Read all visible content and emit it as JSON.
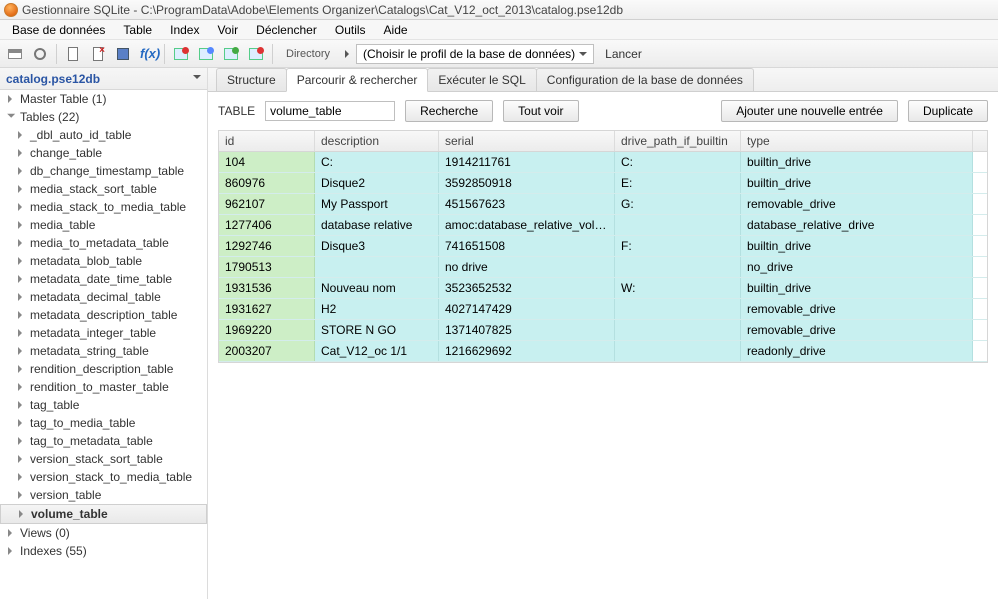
{
  "window": {
    "title": "Gestionnaire SQLite - C:\\ProgramData\\Adobe\\Elements Organizer\\Catalogs\\Cat_V12_oct_2013\\catalog.pse12db"
  },
  "menu": [
    "Base de données",
    "Table",
    "Index",
    "Voir",
    "Déclencher",
    "Outils",
    "Aide"
  ],
  "toolbar": {
    "directory_label": "Directory",
    "profile_placeholder": "(Choisir le profil de la base de données)",
    "launch": "Lancer"
  },
  "sidebar": {
    "title": "catalog.pse12db",
    "master": "Master Table (1)",
    "tables_label": "Tables (22)",
    "tables": [
      "_dbl_auto_id_table",
      "change_table",
      "db_change_timestamp_table",
      "media_stack_sort_table",
      "media_stack_to_media_table",
      "media_table",
      "media_to_metadata_table",
      "metadata_blob_table",
      "metadata_date_time_table",
      "metadata_decimal_table",
      "metadata_description_table",
      "metadata_integer_table",
      "metadata_string_table",
      "rendition_description_table",
      "rendition_to_master_table",
      "tag_table",
      "tag_to_media_table",
      "tag_to_metadata_table",
      "version_stack_sort_table",
      "version_stack_to_media_table",
      "version_table",
      "volume_table"
    ],
    "active_table": "volume_table",
    "views": "Views (0)",
    "indexes": "Indexes (55)"
  },
  "tabs": {
    "items": [
      "Structure",
      "Parcourir & rechercher",
      "Exécuter le SQL",
      "Configuration de la base de données"
    ],
    "active": 1
  },
  "browse": {
    "table_label": "TABLE",
    "table_name": "volume_table",
    "search_btn": "Recherche",
    "showall_btn": "Tout voir",
    "add_btn": "Ajouter une nouvelle entrée",
    "dup_btn": "Duplicate",
    "columns": [
      "id",
      "description",
      "serial",
      "drive_path_if_builtin",
      "type"
    ],
    "rows": [
      {
        "id": "104",
        "description": "C:",
        "serial": "1914211761",
        "drive": "C:",
        "type": "builtin_drive"
      },
      {
        "id": "860976",
        "description": "Disque2",
        "serial": "3592850918",
        "drive": "E:",
        "type": "builtin_drive"
      },
      {
        "id": "962107",
        "description": "My Passport",
        "serial": "451567623",
        "drive": "G:",
        "type": "removable_drive"
      },
      {
        "id": "1277406",
        "description": "database relative",
        "serial": "amoc:database_relative_volume",
        "drive": "",
        "type": "database_relative_drive"
      },
      {
        "id": "1292746",
        "description": "Disque3",
        "serial": "741651508",
        "drive": "F:",
        "type": "builtin_drive"
      },
      {
        "id": "1790513",
        "description": "",
        "serial": "no drive",
        "drive": "",
        "type": "no_drive"
      },
      {
        "id": "1931536",
        "description": "Nouveau nom",
        "serial": "3523652532",
        "drive": "W:",
        "type": "builtin_drive"
      },
      {
        "id": "1931627",
        "description": "H2",
        "serial": "4027147429",
        "drive": "",
        "type": "removable_drive"
      },
      {
        "id": "1969220",
        "description": "STORE N GO",
        "serial": "1371407825",
        "drive": "",
        "type": "removable_drive"
      },
      {
        "id": "2003207",
        "description": "Cat_V12_oc 1/1",
        "serial": "1216629692",
        "drive": "",
        "type": "readonly_drive"
      }
    ]
  }
}
